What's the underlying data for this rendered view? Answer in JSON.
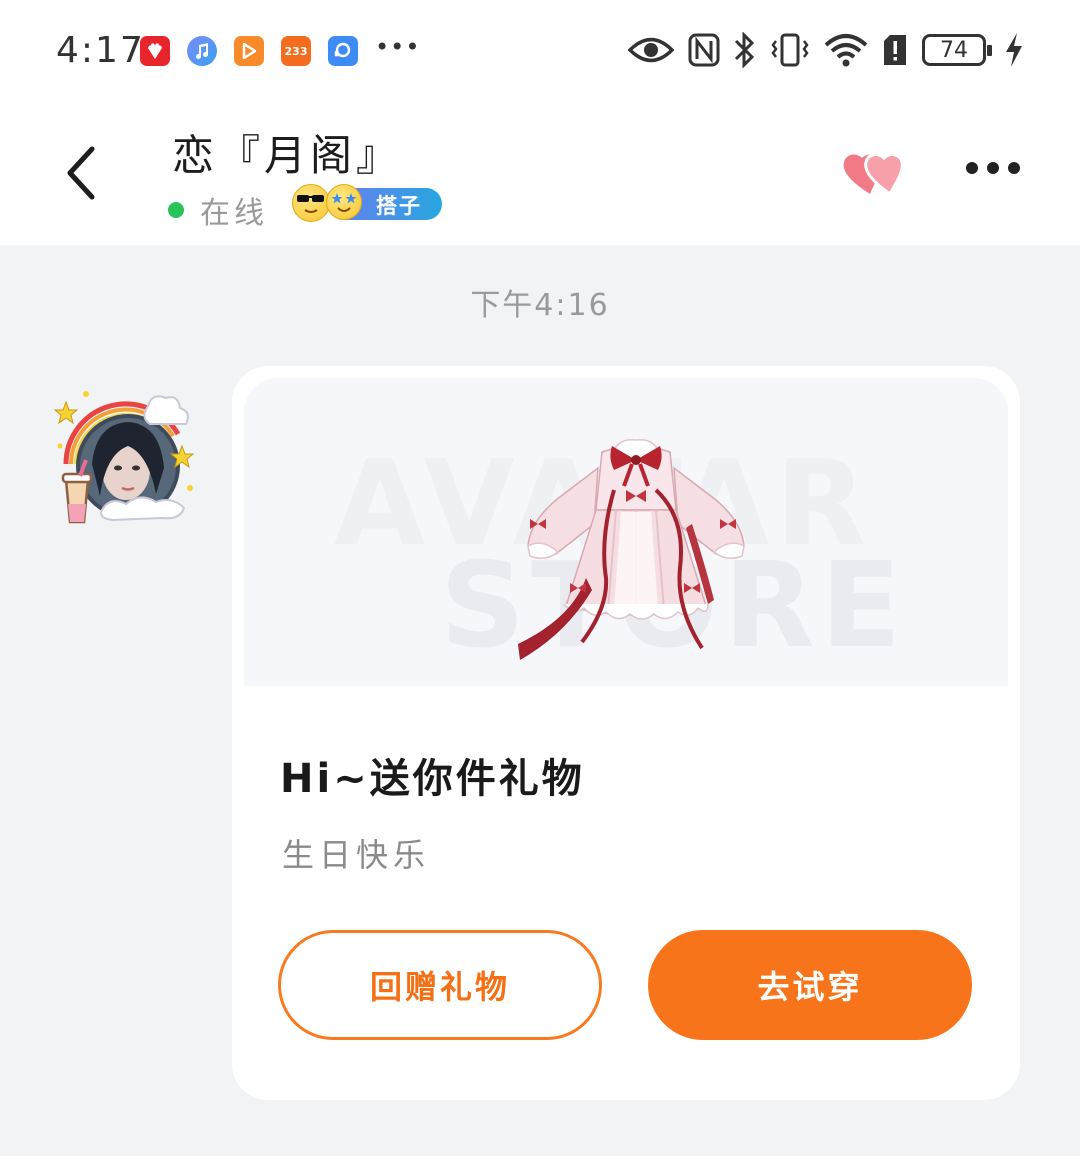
{
  "status_bar": {
    "time": "4:17",
    "battery_level": "74",
    "notification_icons": [
      "huawei-app-icon",
      "music-app-icon",
      "video-app-icon",
      "233-app-icon",
      "chat-app-icon"
    ],
    "notif_233_label": "233",
    "system_icons": [
      "eye-icon",
      "nfc-icon",
      "bluetooth-icon",
      "vibrate-icon",
      "wifi-icon",
      "sim-alert-icon",
      "battery-icon",
      "charging-icon"
    ]
  },
  "header": {
    "contact_name": "恋『月阁』",
    "online_status": "在线",
    "relationship_badge": "搭子"
  },
  "chat": {
    "timestamp": "下午4:16",
    "gift_card": {
      "watermark_line1": "AVATAR",
      "watermark_line2": "STORE",
      "title": "Hi~送你件礼物",
      "message": "生日快乐",
      "return_gift_label": "回赠礼物",
      "try_on_label": "去试穿"
    }
  },
  "colors": {
    "accent_orange": "#f8741a",
    "online_green": "#28c45a",
    "badge_blue": "#27a7e0",
    "heart_pink": "#f27a86"
  }
}
